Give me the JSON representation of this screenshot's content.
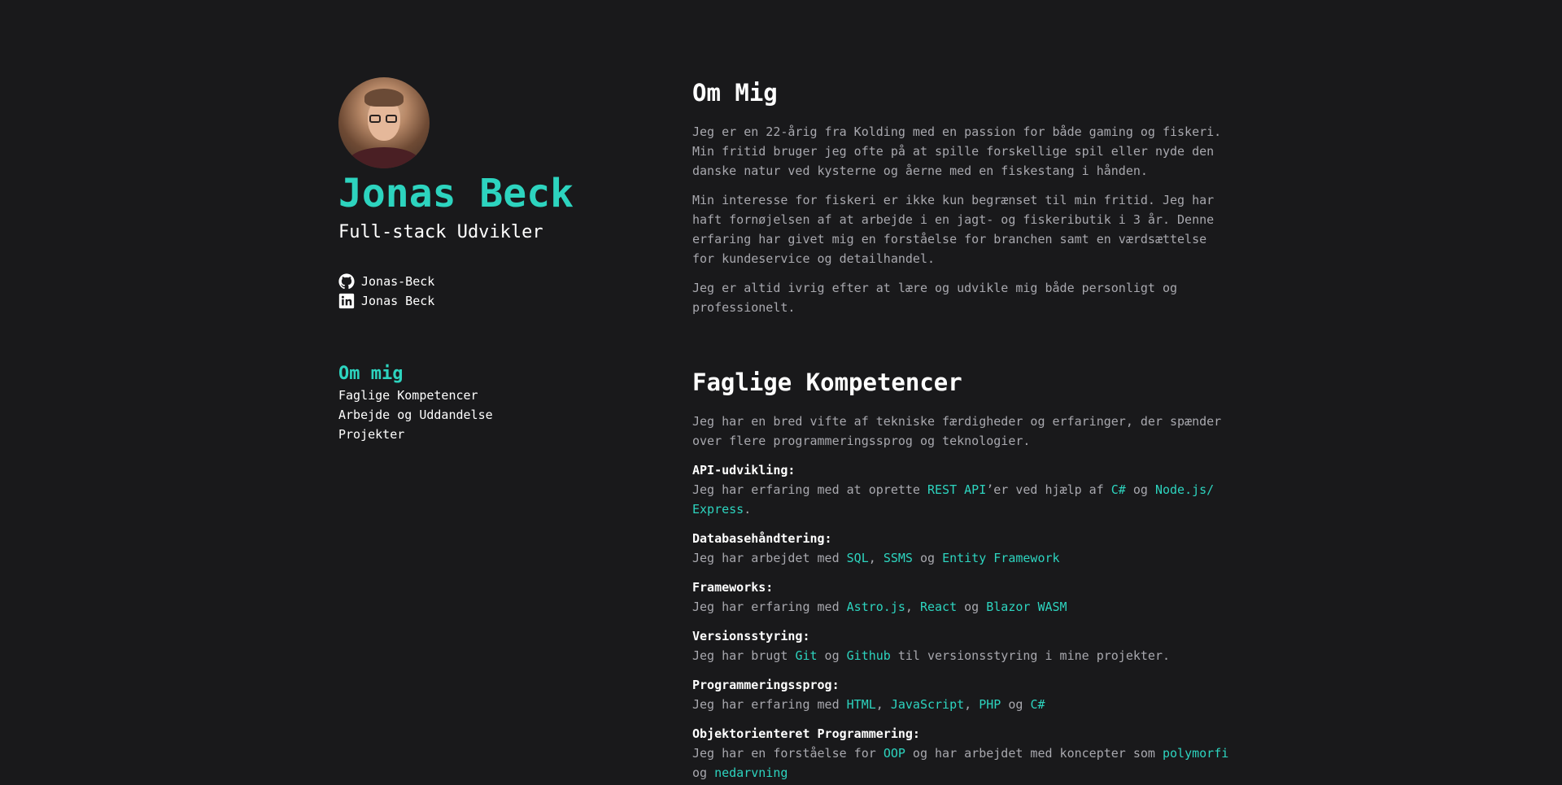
{
  "profile": {
    "name": "Jonas Beck",
    "role": "Full-stack Udvikler",
    "github": "Jonas-Beck",
    "linkedin": "Jonas Beck"
  },
  "nav": {
    "active": "Om mig",
    "items": [
      "Faglige Kompetencer",
      "Arbejde og Uddandelse",
      "Projekter"
    ]
  },
  "about": {
    "title": "Om Mig",
    "paragraphs": [
      "Jeg er en 22-årig fra Kolding med en passion for både gaming og fiskeri. Min fritid bruger jeg ofte på at spille forskellige spil eller nyde den danske natur ved kysterne og åerne med en fiskestang i hånden.",
      "Min interesse for fiskeri er ikke kun begrænset til min fritid. Jeg har haft fornøjelsen af at arbejde i en jagt- og fiskeributik i 3 år. Denne erfaring har givet mig en forståelse for branchen samt en værdsættelse for kundeservice og detailhandel.",
      "Jeg er altid ivrig efter at lære og udvikle mig både personligt og professionelt."
    ]
  },
  "skills": {
    "title": "Faglige Kompetencer",
    "intro": "Jeg har en bred vifte af tekniske færdigheder og erfaringer, der spænder over flere programmeringssprog og teknologier.",
    "api": {
      "title": "API-udvikling:",
      "t1": "Jeg har erfaring med at oprette ",
      "h1": "REST API",
      "t2": "’er ved hjælp af ",
      "h2": "C#",
      "t3": " og ",
      "h3": "Node.js/ Express",
      "t4": "."
    },
    "db": {
      "title": "Databasehåndtering:",
      "t1": "Jeg har arbejdet med ",
      "h1": "SQL",
      "t2": ", ",
      "h2": "SSMS",
      "t3": " og ",
      "h3": "Entity Framework"
    },
    "fw": {
      "title": "Frameworks:",
      "t1": "Jeg har erfaring med ",
      "h1": "Astro.js",
      "t2": ", ",
      "h2": "React",
      "t3": " og ",
      "h3": "Blazor WASM"
    },
    "vcs": {
      "title": "Versionsstyring:",
      "t1": "Jeg har brugt ",
      "h1": "Git",
      "t2": " og ",
      "h2": "Github",
      "t3": " til versionsstyring i mine projekter."
    },
    "lang": {
      "title": "Programmeringssprog:",
      "t1": "Jeg har erfaring med ",
      "h1": "HTML",
      "t2": ", ",
      "h2": "JavaScript",
      "t3": ", ",
      "h3": "PHP",
      "t4": " og ",
      "h4": "C#"
    },
    "oop": {
      "title": "Objektorienteret Programmering:",
      "t1": "Jeg har en forståelse for ",
      "h1": "OOP",
      "t2": " og har arbejdet med koncepter som ",
      "h2": "polymorfi",
      "t3": " og ",
      "h3": "nedarvning"
    }
  },
  "colors": {
    "background": "#19191b",
    "accent": "#2dd4bf",
    "body_text": "#a8a8ae",
    "heading": "#ffffff"
  }
}
